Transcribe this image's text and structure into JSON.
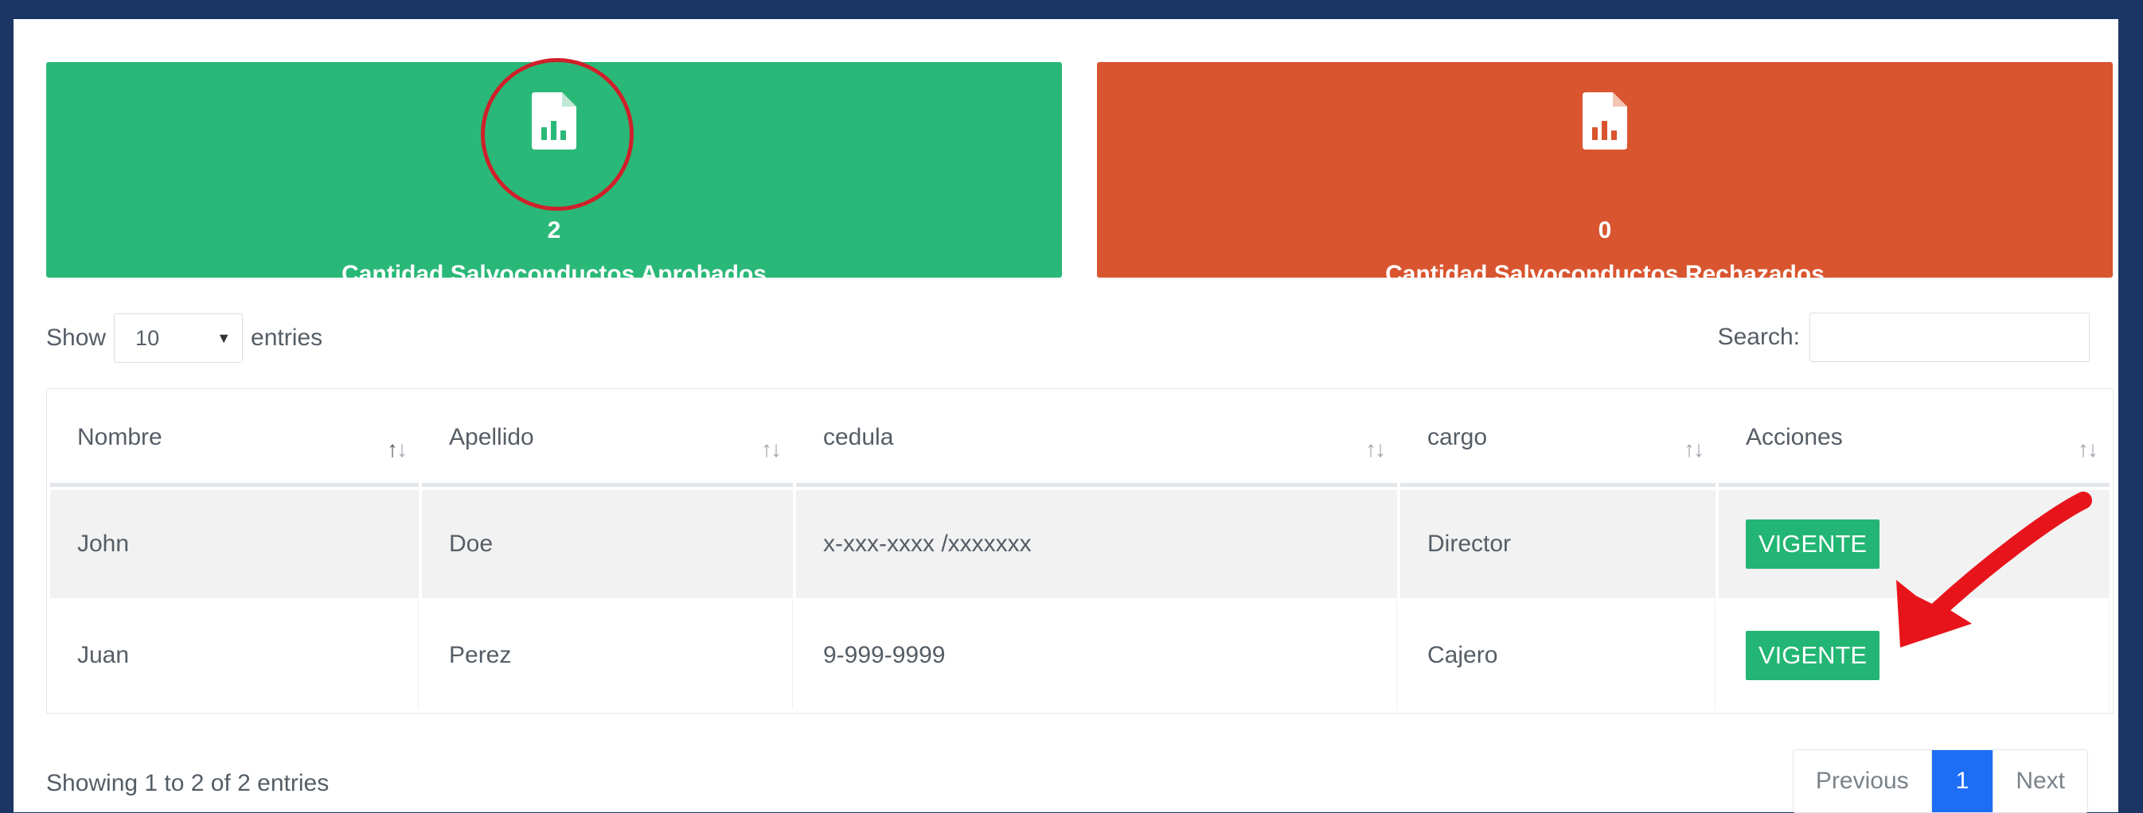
{
  "cards": {
    "approved": {
      "count": "2",
      "label": "Cantidad Salvoconductos Aprobados",
      "color": "#2ab878",
      "icon": "report-file-icon"
    },
    "rejected": {
      "count": "0",
      "label": "Cantidad Salvoconductos Rechazados",
      "color": "#d9552f",
      "icon": "report-file-icon"
    }
  },
  "length": {
    "show_label": "Show",
    "selected": "10",
    "entries_label": "entries"
  },
  "search": {
    "label": "Search:",
    "value": ""
  },
  "table": {
    "headers": [
      "Nombre",
      "Apellido",
      "cedula",
      "cargo",
      "Acciones"
    ],
    "rows": [
      {
        "nombre": "John",
        "apellido": "Doe",
        "cedula": "x-xxx-xxxx /xxxxxxx",
        "cargo": "Director",
        "accion": "VIGENTE"
      },
      {
        "nombre": "Juan",
        "apellido": "Perez",
        "cedula": "9-999-9999",
        "cargo": "Cajero",
        "accion": "VIGENTE"
      }
    ]
  },
  "info": "Showing 1 to 2 of 2 entries",
  "pagination": {
    "previous": "Previous",
    "current": "1",
    "next": "Next"
  },
  "colors": {
    "accent": "#1e6ef5",
    "badge": "#22b573",
    "frame": "#1b3564",
    "annotation": "#e8141c"
  }
}
